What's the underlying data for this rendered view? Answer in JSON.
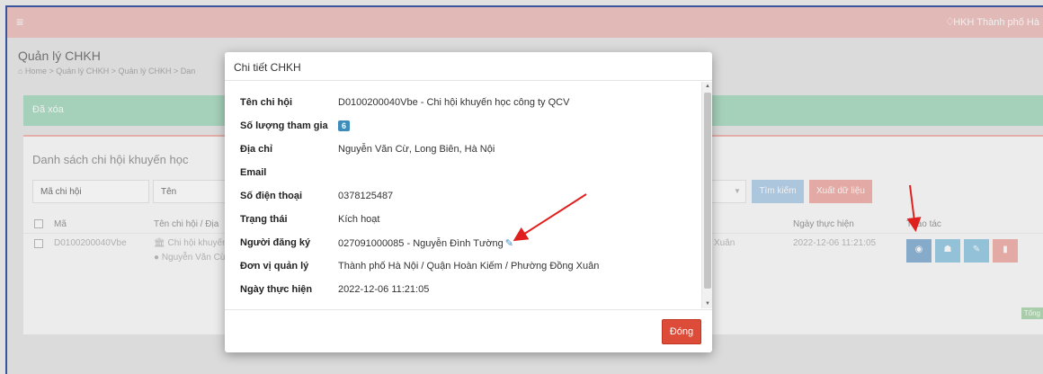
{
  "topbar": {
    "menu_icon": "hamburger-icon",
    "bell_icon": "bell-icon",
    "user": "HKH Thành phố Hà"
  },
  "page": {
    "title": "Quản lý CHKH",
    "breadcrumb": "⌂ Home  >  Quản lý CHKH  >  Quản lý CHKH  >  Dan"
  },
  "alert": {
    "text": "Đã xóa",
    "color": "#b0ddc5"
  },
  "panel": {
    "title": "Danh sách chi hội khuyến học",
    "filters": {
      "code_placeholder": "Mã chi hội",
      "name_placeholder": "Tên"
    },
    "search_label": "Tìm kiếm",
    "export_label": "Xuất dữ liệu",
    "headers": {
      "code": "Mã",
      "name": "Tên chi hội / Địa",
      "date": "Ngày thực hiện",
      "actions": "Thao tác"
    },
    "rows": [
      {
        "code": "D0100200040Vbe",
        "name": "Chi hội khuyến",
        "address": "Nguyễn Văn Cừ",
        "region": "Xuân",
        "date": "2022-12-06 11:21:05"
      }
    ],
    "total_badge": "Tổng"
  },
  "modal": {
    "title": "Chi tiết CHKH",
    "fields": {
      "name_label": "Tên chi hội",
      "name_value": "D0100200040Vbe - Chi hội khuyến học công ty QCV",
      "count_label": "Số lượng tham gia",
      "count_value": "6",
      "address_label": "Địa chỉ",
      "address_value": "Nguyễn Văn Cừ, Long Biên, Hà Nội",
      "email_label": "Email",
      "email_value": "",
      "phone_label": "Số điện thoại",
      "phone_value": "0378125487",
      "status_label": "Trạng thái",
      "status_value": "Kích hoạt",
      "registrant_label": "Người đăng ký",
      "registrant_value": "027091000085 - Nguyễn Đình Tường",
      "unit_label": "Đơn vị quản lý",
      "unit_value": "Thành phố Hà Nội / Quận Hoàn Kiếm / Phường Đồng Xuân",
      "date_label": "Ngày thực hiện",
      "date_value": "2022-12-06 11:21:05"
    },
    "close_label": "Đóng"
  },
  "colors": {
    "topbar": "#f0c6c4",
    "accent_blue": "#3c8dbc",
    "danger": "#dd4b39",
    "annotation_arrow": "#e0201e"
  }
}
